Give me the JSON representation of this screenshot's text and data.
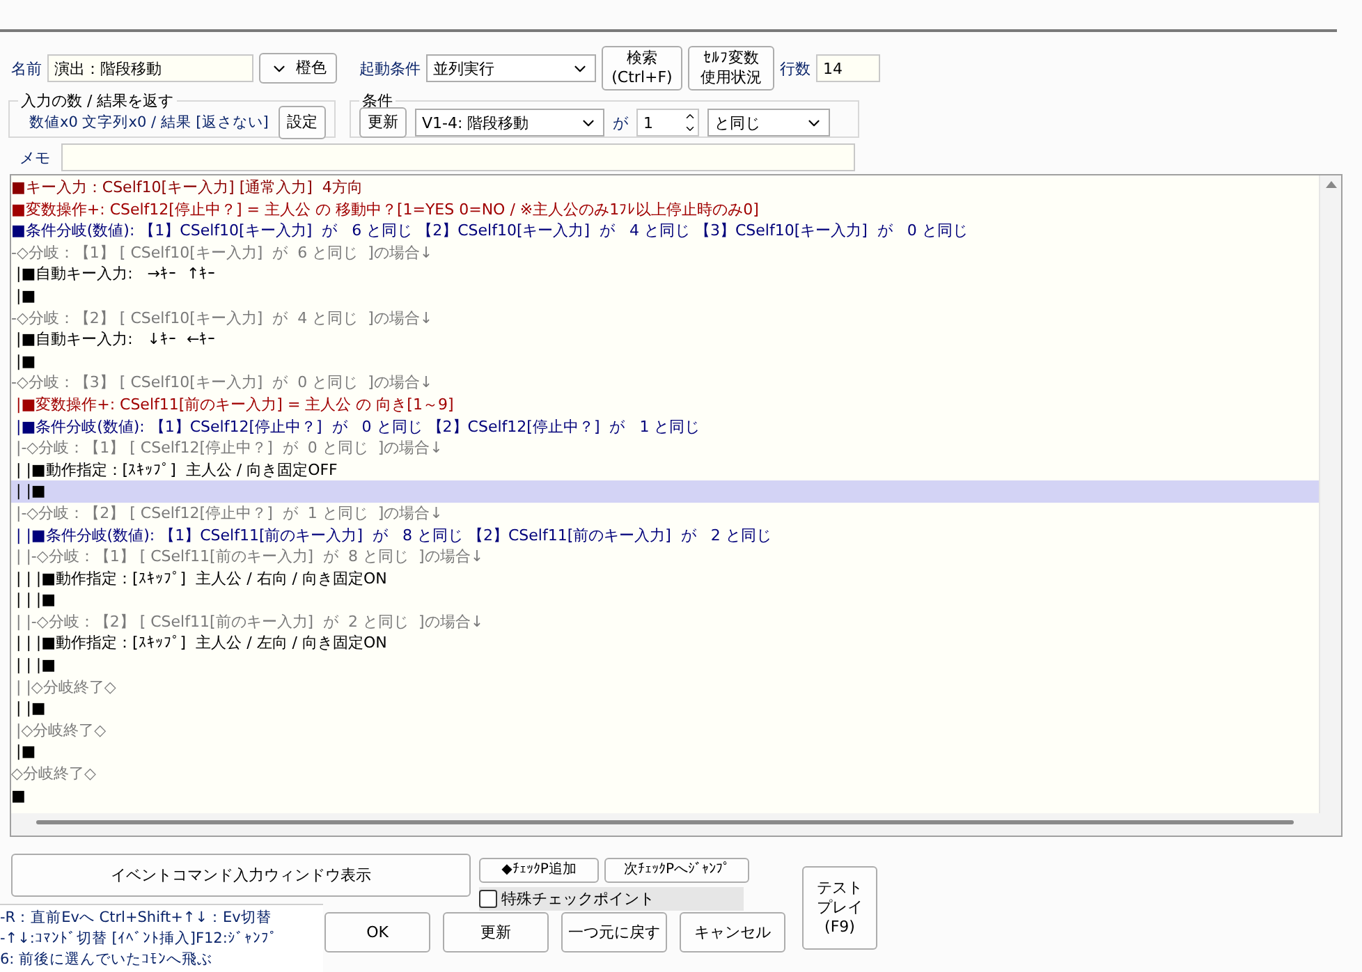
{
  "header": {
    "name_label": "名前",
    "name_value": "演出：階段移動",
    "color_button": "橙色",
    "trigger_label": "起動条件",
    "trigger_value": "並列実行",
    "search_button": "検索\n(Ctrl+F)",
    "self_var_button": "ｾﾙﾌ変数使用状況",
    "lines_label": "行数",
    "lines_value": "14"
  },
  "io_group": {
    "title": "入力の数 / 結果を返す",
    "summary": "数値x0 文字列x0 / 結果 [返さない]",
    "set_button": "設定"
  },
  "condition_group": {
    "title": "条件",
    "update_button": "更新",
    "variable": "V1-4: 階段移動",
    "ga": "が",
    "value": "1",
    "compare": "と同じ"
  },
  "memo": {
    "label": "メモ"
  },
  "script_lines": [
    {
      "kind": "input",
      "text": "■キー入力：CSelf10[キー入力] [通常入力]  4方向",
      "selected": false
    },
    {
      "kind": "varop",
      "text": "■変数操作+: CSelf12[停止中？] = 主人公 の 移動中？[1=YES 0=NO / ※主人公のみ1ﾌﾚ以上停止時のみ0]",
      "selected": false
    },
    {
      "kind": "branch",
      "text": "■条件分岐(数値): 【1】CSelf10[キー入力]  が   6 と同じ 【2】CSelf10[キー入力]  が   4 と同じ 【3】CSelf10[キー入力]  が   0 と同じ",
      "selected": false
    },
    {
      "kind": "case",
      "text": "-◇分岐：【1】 [ CSelf10[キー入力]  が  6 と同じ  ]の場合↓",
      "selected": false
    },
    {
      "kind": "command",
      "text": " |■自動キー入力:   →ｷｰ  ↑ｷｰ",
      "selected": false
    },
    {
      "kind": "command",
      "text": " |■",
      "selected": false
    },
    {
      "kind": "case",
      "text": "-◇分岐：【2】 [ CSelf10[キー入力]  が  4 と同じ  ]の場合↓",
      "selected": false
    },
    {
      "kind": "command",
      "text": " |■自動キー入力:   ↓ｷｰ  ←ｷｰ",
      "selected": false
    },
    {
      "kind": "command",
      "text": " |■",
      "selected": false
    },
    {
      "kind": "case",
      "text": "-◇分岐：【3】 [ CSelf10[キー入力]  が  0 と同じ  ]の場合↓",
      "selected": false
    },
    {
      "kind": "varop",
      "text": " |■変数操作+: CSelf11[前のキー入力] = 主人公 の 向き[1～9]",
      "selected": false
    },
    {
      "kind": "branch",
      "text": " |■条件分岐(数値): 【1】CSelf12[停止中？]  が   0 と同じ 【2】CSelf12[停止中？]  が   1 と同じ",
      "selected": false
    },
    {
      "kind": "case",
      "text": " |-◇分岐：【1】 [ CSelf12[停止中？]  が  0 と同じ  ]の場合↓",
      "selected": false
    },
    {
      "kind": "command",
      "text": " | |■動作指定：[ｽｷｯﾌﾟ]  主人公 / 向き固定OFF",
      "selected": false
    },
    {
      "kind": "command",
      "text": " | |■",
      "selected": true
    },
    {
      "kind": "case",
      "text": " |-◇分岐：【2】 [ CSelf12[停止中？]  が  1 と同じ  ]の場合↓",
      "selected": false
    },
    {
      "kind": "branch",
      "text": " | |■条件分岐(数値): 【1】CSelf11[前のキー入力]  が   8 と同じ 【2】CSelf11[前のキー入力]  が   2 と同じ",
      "selected": false
    },
    {
      "kind": "case",
      "text": " | |-◇分岐：【1】 [ CSelf11[前のキー入力]  が  8 と同じ  ]の場合↓",
      "selected": false
    },
    {
      "kind": "command",
      "text": " | | |■動作指定：[ｽｷｯﾌﾟ]  主人公 / 右向 / 向き固定ON",
      "selected": false
    },
    {
      "kind": "command",
      "text": " | | |■",
      "selected": false
    },
    {
      "kind": "case",
      "text": " | |-◇分岐：【2】 [ CSelf11[前のキー入力]  が  2 と同じ  ]の場合↓",
      "selected": false
    },
    {
      "kind": "command",
      "text": " | | |■動作指定：[ｽｷｯﾌﾟ]  主人公 / 左向 / 向き固定ON",
      "selected": false
    },
    {
      "kind": "command",
      "text": " | | |■",
      "selected": false
    },
    {
      "kind": "case",
      "text": " | |◇分岐終了◇",
      "selected": false
    },
    {
      "kind": "command",
      "text": " | |■",
      "selected": false
    },
    {
      "kind": "case",
      "text": " |◇分岐終了◇",
      "selected": false
    },
    {
      "kind": "command",
      "text": " |■",
      "selected": false
    },
    {
      "kind": "case",
      "text": "◇分岐終了◇",
      "selected": false
    },
    {
      "kind": "command",
      "text": "■",
      "selected": false
    }
  ],
  "footer": {
    "command_window_button": "イベントコマンド入力ウィンドウ表示",
    "add_checkpoint_button": "◆ﾁｪｯｸP追加",
    "next_checkpoint_button": "次ﾁｪｯｸPへｼﾞｬﾝﾌﾟ",
    "special_checkpoint": {
      "label": "特殊チェックポイント",
      "checked": false
    },
    "help_lines": [
      "-R：直前Evへ  Ctrl+Shift+↑↓：Ev切替",
      "-↑↓:ｺﾏﾝﾄﾞ切替  [ｲﾍﾞﾝﾄ挿入]F12:ｼﾞｬﾝﾌﾟ",
      "6: 前後に選んでいたｺﾓﾝへ飛ぶ"
    ],
    "buttons": [
      "OK",
      "更新",
      "一つ元に戻す",
      "キャンセル"
    ],
    "test_play_button": "テストプレイ(F9)"
  }
}
